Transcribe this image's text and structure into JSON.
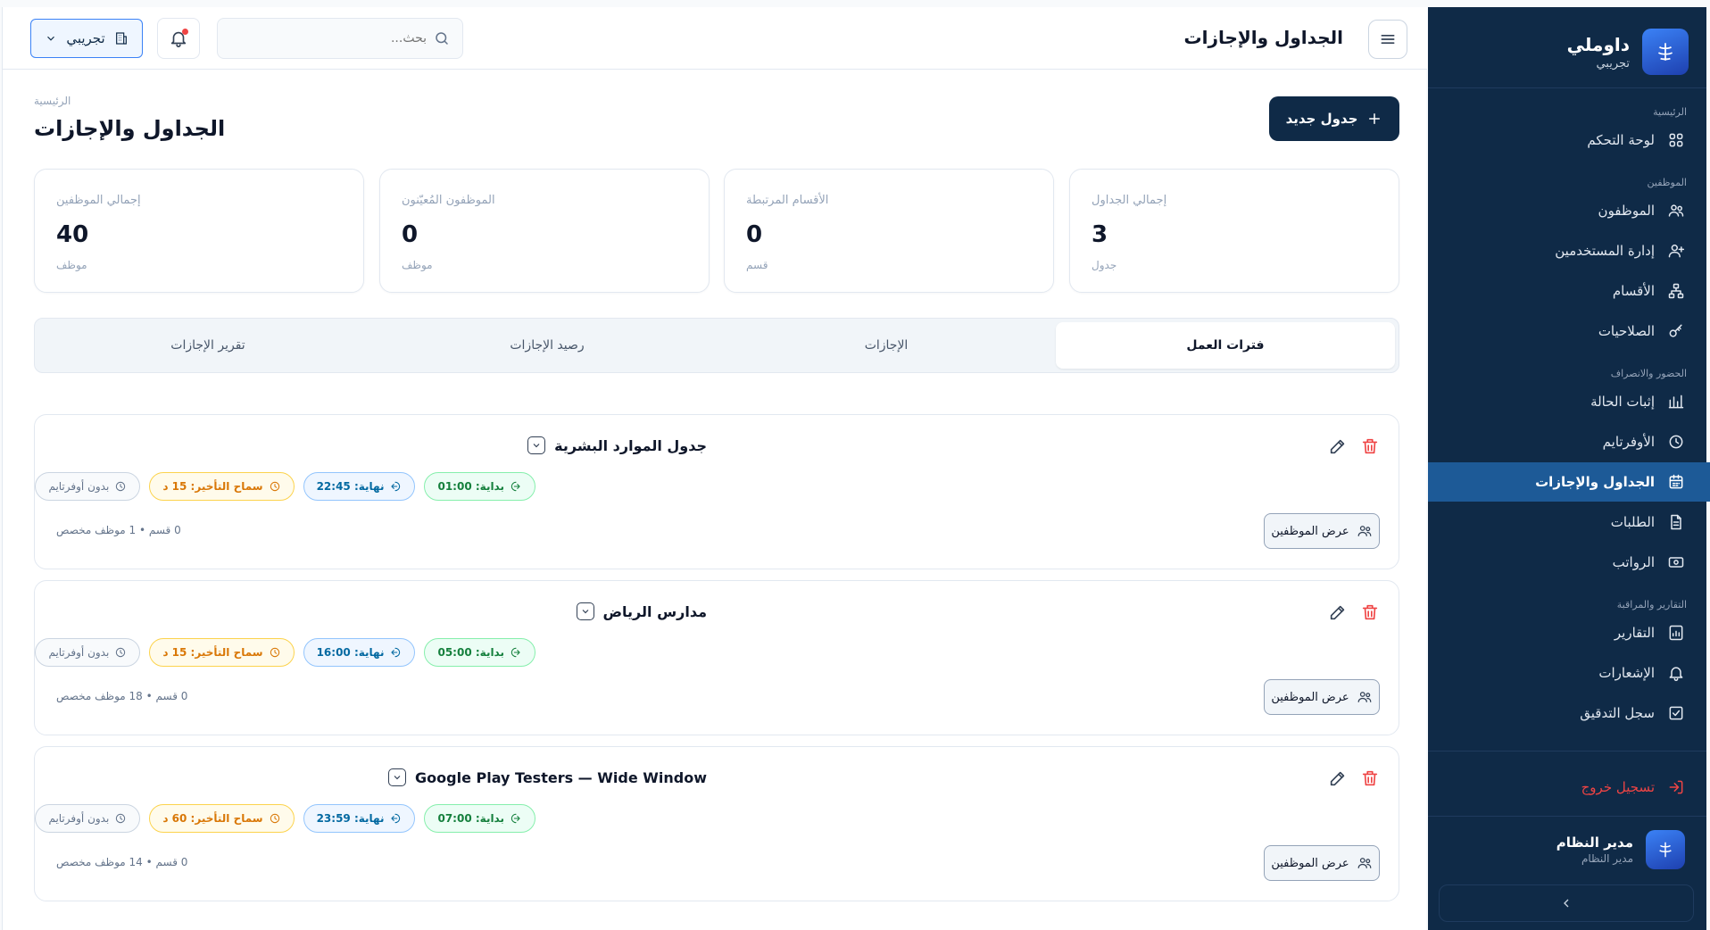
{
  "sidebar": {
    "brand_name": "داوملي",
    "brand_sub": "تجريبي",
    "sections": [
      {
        "label": "الرئيسية",
        "items": [
          {
            "label": "لوحة التحكم",
            "icon": "grid-icon"
          }
        ]
      },
      {
        "label": "الموظفين",
        "items": [
          {
            "label": "الموظفون",
            "icon": "users-icon"
          },
          {
            "label": "إدارة المستخدمين",
            "icon": "user-plus-icon"
          },
          {
            "label": "الأقسام",
            "icon": "sitemap-icon"
          },
          {
            "label": "الصلاحيات",
            "icon": "key-icon"
          }
        ]
      },
      {
        "label": "الحضور والانصراف",
        "items": [
          {
            "label": "إثبات الحالة",
            "icon": "bar-chart-icon"
          },
          {
            "label": "الأوفرتايم",
            "icon": "clock-icon"
          },
          {
            "label": "الجداول والإجازات",
            "icon": "calendar-icon",
            "active": true
          },
          {
            "label": "الطلبات",
            "icon": "file-icon"
          },
          {
            "label": "الرواتب",
            "icon": "money-icon"
          }
        ]
      },
      {
        "label": "التقارير والمراقبة",
        "items": [
          {
            "label": "التقارير",
            "icon": "report-icon"
          },
          {
            "label": "الإشعارات",
            "icon": "bell-icon"
          },
          {
            "label": "سجل التدقيق",
            "icon": "checklist-icon"
          }
        ]
      }
    ],
    "logout": "تسجيل خروج",
    "user_name": "مدير النظام",
    "user_role": "مدير النظام"
  },
  "topbar": {
    "title": "الجداول والإجازات",
    "search_placeholder": "بحث...",
    "org": "تجريبي"
  },
  "page": {
    "breadcrumb": "الرئيسية",
    "title": "الجداول والإجازات",
    "new_button": "جدول جديد"
  },
  "stats": [
    {
      "label": "إجمالي الجداول",
      "value": "3",
      "unit": "جدول"
    },
    {
      "label": "الأقسام المرتبطة",
      "value": "0",
      "unit": "قسم"
    },
    {
      "label": "الموظفون المُعيّنون",
      "value": "0",
      "unit": "موظف"
    },
    {
      "label": "إجمالي الموظفين",
      "value": "40",
      "unit": "موظف"
    }
  ],
  "tabs": [
    {
      "label": "فترات العمل",
      "active": true
    },
    {
      "label": "الإجازات"
    },
    {
      "label": "رصيد الإجازات"
    },
    {
      "label": "تقرير الإجازات"
    }
  ],
  "schedules": [
    {
      "name": "جدول الموارد البشرية",
      "start": "بداية: 01:00",
      "end": "نهاية: 22:45",
      "grace": "سماح التأخير: 15 د",
      "overtime": "بدون أوفرتايم",
      "meta": "0 قسم • 1 موظف مخصص",
      "view": "عرض الموظفين"
    },
    {
      "name": "مدارس الرياض",
      "start": "بداية: 05:00",
      "end": "نهاية: 16:00",
      "grace": "سماح التأخير: 15 د",
      "overtime": "بدون أوفرتايم",
      "meta": "0 قسم • 18 موظف مخصص",
      "view": "عرض الموظفين"
    },
    {
      "name": "Google Play Testers — Wide Window",
      "start": "بداية: 07:00",
      "end": "نهاية: 23:59",
      "grace": "سماح التأخير: 60 د",
      "overtime": "بدون أوفرتايم",
      "meta": "0 قسم • 14 موظف مخصص",
      "view": "عرض الموظفين"
    }
  ],
  "colors": {
    "sidebar_bg": "#0f2a47",
    "active_item": "#1d5a97",
    "primary": "#0f2a47",
    "danger": "#ef4444"
  }
}
